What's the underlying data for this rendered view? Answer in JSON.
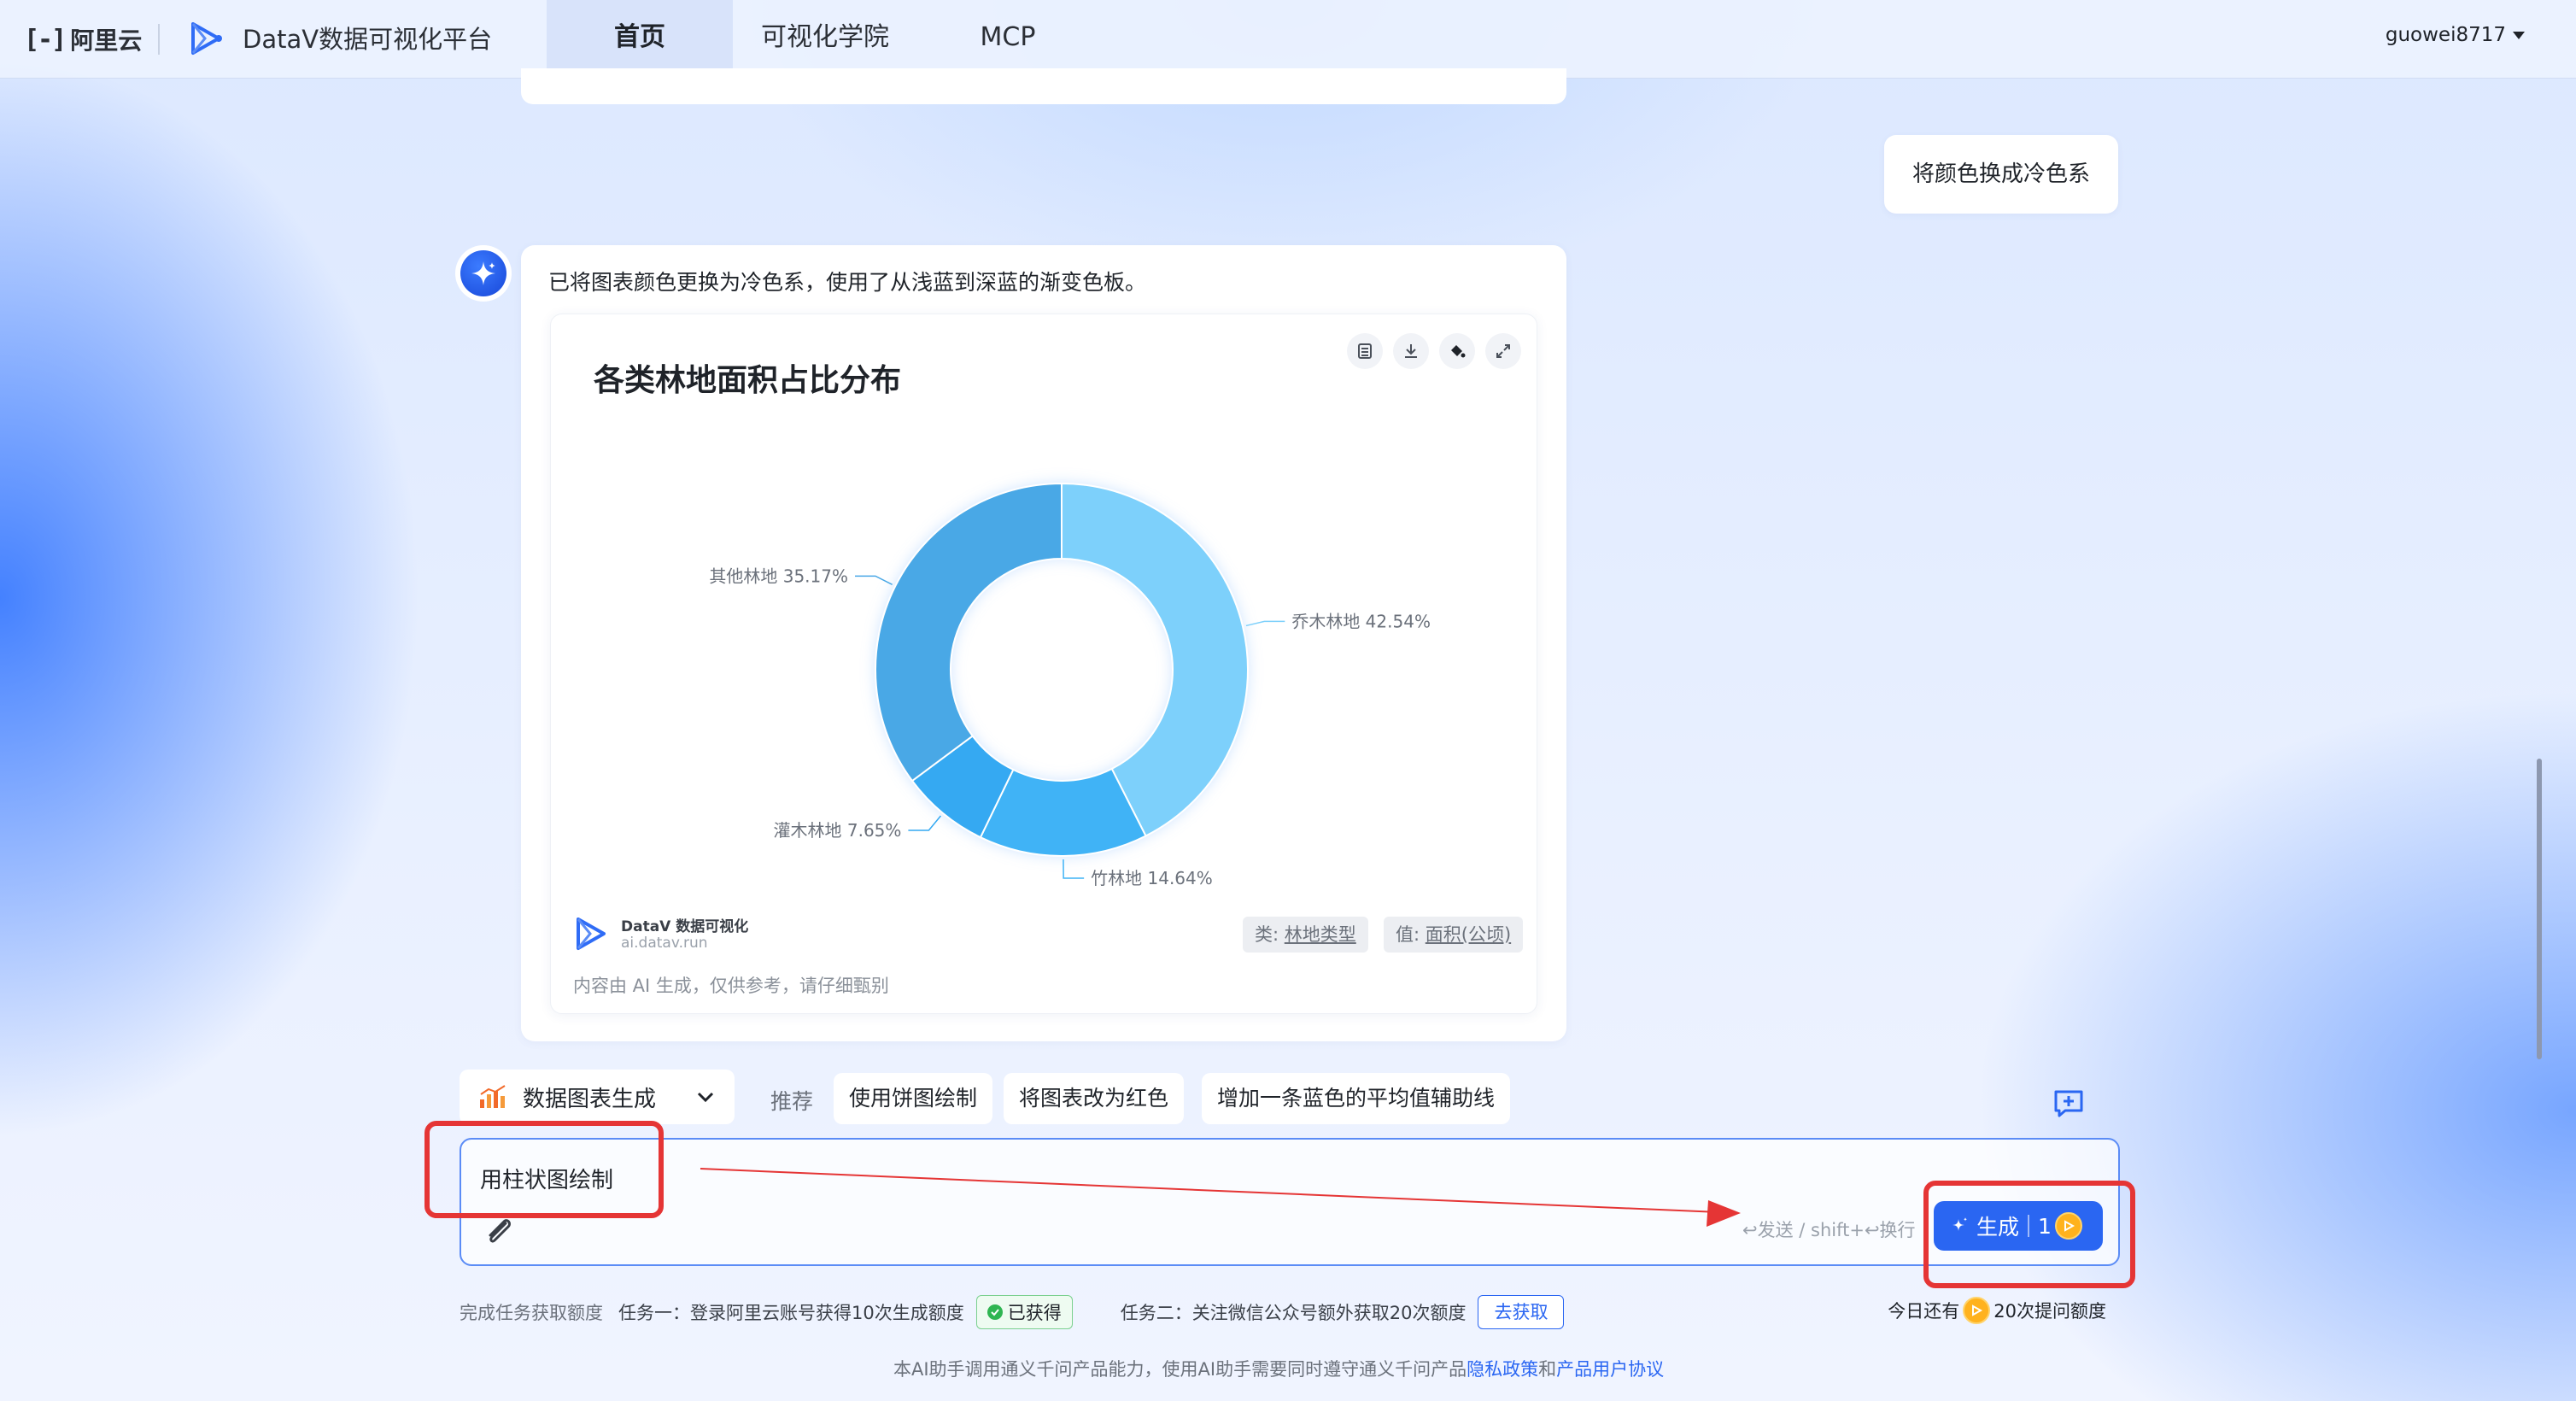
{
  "header": {
    "aliyun_mark": "[-]",
    "aliyun_name": "阿里云",
    "app_title": "DataV数据可视化平台",
    "tabs": [
      {
        "label": "首页",
        "active": true
      },
      {
        "label": "可视化学院",
        "active": false
      },
      {
        "label": "MCP",
        "active": false
      }
    ],
    "username": "guowei8717"
  },
  "chat": {
    "user_message": "将颜色换成冷色系",
    "ai_message": "已将图表颜色更换为冷色系，使用了从浅蓝到深蓝的渐变色板。"
  },
  "chart_data": {
    "type": "pie",
    "donut": true,
    "title": "各类林地面积占比分布",
    "slices": [
      {
        "label": "乔木林地",
        "value": 42.54,
        "display": "乔木林地 42.54%"
      },
      {
        "label": "竹林地",
        "value": 14.64,
        "display": "竹林地 14.64%"
      },
      {
        "label": "灌木林地",
        "value": 7.65,
        "display": "灌木林地 7.65%"
      },
      {
        "label": "其他林地",
        "value": 35.17,
        "display": "其他林地 35.17%"
      }
    ],
    "colors": [
      "#7dd0fb",
      "#3fb3f6",
      "#34a9f2",
      "#4aa8e6"
    ],
    "tools": [
      "table-icon",
      "download-icon",
      "paint-bucket-icon",
      "expand-icon"
    ],
    "footer": {
      "brand": "DataV 数据可视化",
      "domain": "ai.datav.run",
      "disclaimer": "内容由 AI 生成，仅供参考，请仔细甄别",
      "category_prefix": "类:",
      "category_field": "林地类型",
      "value_prefix": "值:",
      "value_field": "面积(公顷)"
    }
  },
  "composer": {
    "mode_label": "数据图表生成",
    "recommend_label": "推荐",
    "suggestions": [
      "使用饼图绘制",
      "将图表改为红色",
      "增加一条蓝色的平均值辅助线"
    ],
    "input_value": "用柱状图绘制",
    "send_hint": "↩发送 / shift+↩换行",
    "generate_label": "生成",
    "generate_cost": "1"
  },
  "tasks": {
    "intro": "完成任务获取额度",
    "task1": "任务一：登录阿里云账号获得10次生成额度",
    "task1_status": "已获得",
    "task2": "任务二：关注微信公众号额外获取20次额度",
    "task2_action": "去获取",
    "quota_prefix": "今日还有",
    "quota_suffix": "20次提问额度"
  },
  "footer": {
    "text": "本AI助手调用通义千问产品能力，使用AI助手需要同时遵守通义千问产品",
    "privacy_link": "隐私政策",
    "and": "和",
    "terms_link": "产品用户协议"
  },
  "colors": {
    "accent": "#2a66f2",
    "annotation": "#e53535"
  }
}
